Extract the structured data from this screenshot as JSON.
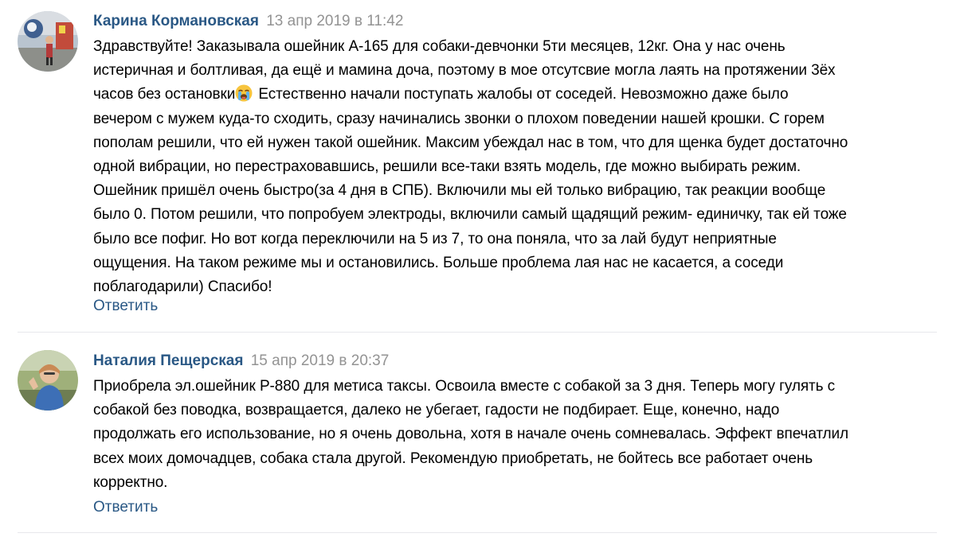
{
  "comments": [
    {
      "author": "Карина Кормановская",
      "date": "13 апр 2019 в 11:42",
      "avatar_icon": "user-photo-avatar",
      "lines": [
        "Здравствуйте! Заказывала ошейник А-165 для собаки-девчонки 5ти месяцев, 12кг. Она у нас очень",
        "истеричная и болтливая, да ещё и мамина доча, поэтому в мое отсутсвие могла лаять на протяжении 3ёх",
        "часов без остановки",
        " Естественно начали поступать жалобы от соседей. Невозможно даже было",
        "вечером с мужем куда-то сходить, сразу начинались звонки о плохом поведении нашей крошки. С горем",
        "пополам решили, что ей нужен такой ошейник. Максим убеждал нас в том, что для щенка будет достаточно",
        "одной вибрации, но перестраховавшись, решили все-таки взять модель, где можно выбирать режим.",
        "Ошейник пришёл очень быстро(за 4 дня в СПБ). Включили мы ей только вибрацию, так реакции вообще",
        "было 0. Потом решили, что попробуем электроды, включили самый щадящий режим- единичку, так ей тоже",
        "было все пофиг. Но вот когда переключили на 5 из 7, то она поняла, что за лай будут неприятные",
        "ощущения. На таком режиме мы и остановились. Больше проблема лая нас не касается, а соседи",
        "поблагодарили) Спасибо!"
      ],
      "emoji_icon": "loudly-crying-face-emoji",
      "reply_label": "Ответить"
    },
    {
      "author": "Наталия Пещерская",
      "date": "15 апр 2019 в 20:37",
      "avatar_icon": "user-photo-avatar",
      "lines": [
        "Приобрела эл.ошейник Р-880 для метиса таксы. Освоила вместе с собакой за 3 дня. Теперь могу гулять с",
        "собакой без поводка, возвращается, далеко не убегает, гадости не подбирает. Еще, конечно, надо",
        "продолжать его использование, но я очень довольна, хотя в начале очень сомневалась. Эффект впечатлил",
        "всех моих домочадцев, собака стала другой. Рекомендую приобретать, не бойтесь все работает очень",
        "корректно."
      ],
      "reply_label": "Ответить"
    }
  ],
  "colors": {
    "author_link": "#2a5885",
    "date_text": "#939393",
    "body_text": "#000000",
    "divider": "#e7e8ec"
  }
}
